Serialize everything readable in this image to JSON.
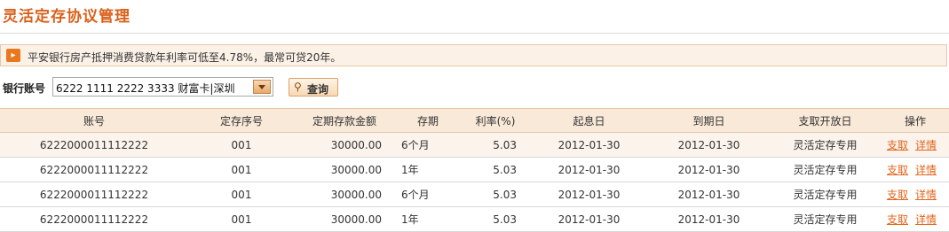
{
  "page": {
    "title": "灵活定存协议管理"
  },
  "notice": {
    "icon": "speaker-icon",
    "text": "平安银行房产抵押消费贷款年利率可低至4.78%，最常可贷20年。"
  },
  "account": {
    "label": "银行账号",
    "selected": "6222 1111 2222 3333 财富卡|深圳",
    "query_label": "查询"
  },
  "table": {
    "headers": [
      "账号",
      "定存序号",
      "定期存款金额",
      "存期",
      "利率(%)",
      "起息日",
      "到期日",
      "支取开放日",
      "操作"
    ],
    "rows": [
      [
        "6222000011112222",
        "001",
        "30000.00",
        "6个月",
        "5.03",
        "2012-01-30",
        "2012-01-30",
        "灵活定存专用",
        "支取",
        "详情"
      ],
      [
        "6222000011112222",
        "001",
        "30000.00",
        "1年",
        "5.03",
        "2012-01-30",
        "2012-01-30",
        "灵活定存专用",
        "支取",
        "详情"
      ],
      [
        "6222000011112222",
        "001",
        "30000.00",
        "6个月",
        "5.03",
        "2012-01-30",
        "2012-01-30",
        "灵活定存专用",
        "支取",
        "详情"
      ],
      [
        "6222000011112222",
        "001",
        "30000.00",
        "1年",
        "5.03",
        "2012-01-30",
        "2012-01-30",
        "灵活定存专用",
        "支取",
        "详情"
      ]
    ]
  },
  "colors": {
    "accent": "#d9601a",
    "header_bg": "#f9e9d8",
    "link": "#e0661c"
  }
}
